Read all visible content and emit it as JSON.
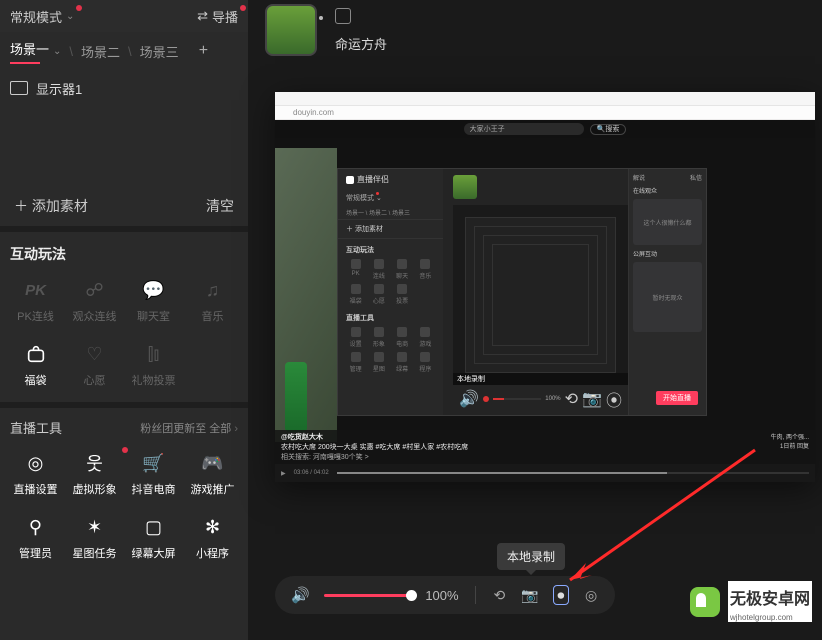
{
  "topbar": {
    "mode": "常规模式",
    "cast": "导播"
  },
  "scenes": {
    "items": [
      "场景一",
      "场景二",
      "场景三"
    ]
  },
  "monitor": {
    "label": "显示器1"
  },
  "add_row": {
    "add": "添加素材",
    "clear": "清空"
  },
  "interactive": {
    "title": "互动玩法",
    "items": [
      "PK连线",
      "观众连线",
      "聊天室",
      "音乐",
      "福袋",
      "心愿",
      "礼物投票",
      ""
    ]
  },
  "tools": {
    "title": "直播工具",
    "promo": "粉丝团更新至 全部",
    "items": [
      "直播设置",
      "虚拟形象",
      "抖音电商",
      "游戏推广",
      "管理员",
      "星图任务",
      "绿幕大屏",
      "小程序"
    ]
  },
  "banner": {
    "title": "命运方舟"
  },
  "window": {
    "url": "douyin.com",
    "search": "大家小王子",
    "btn": "搜索",
    "inner_title": "直播伴侣",
    "inner_start": "开始直播",
    "inner_caption": "本地录制",
    "rpanel_head": "在线观众",
    "rcard1": "这个人很懒什么都",
    "rcard2": "暂时无观众"
  },
  "video_desc": {
    "user": "@吃货赵大木",
    "line": "农村吃大席 200块一大桌 实惠 #吃大席 #村里人家 #农村吃席",
    "related": "相关搜索: 河南嘎嘎30个笑 >",
    "right_meta": "牛肉, 两个强...",
    "date": "1日前 回复"
  },
  "playbar": {
    "time": "03:06 / 04:02"
  },
  "bottom": {
    "vol": "100%"
  },
  "tooltip": "本地录制",
  "watermark": {
    "name": "无极安卓网",
    "url": "wjhotelgroup.com"
  }
}
